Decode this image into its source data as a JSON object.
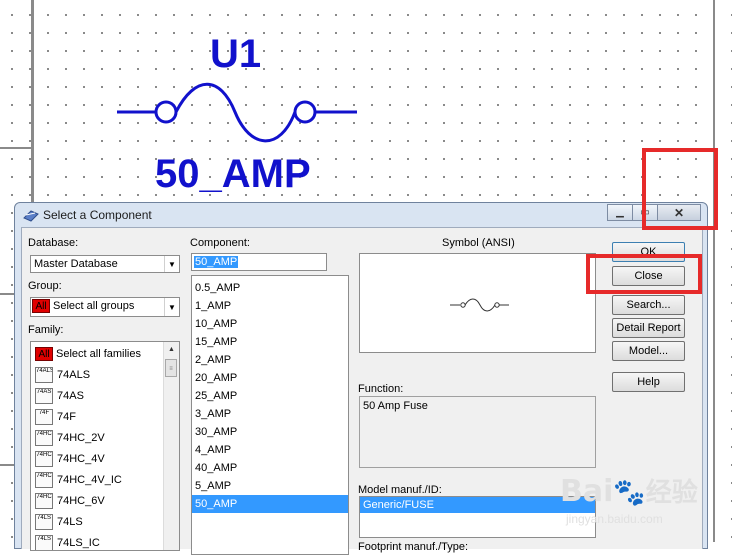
{
  "schematic": {
    "reference": "U1",
    "value": "50_AMP"
  },
  "dialog": {
    "title": "Select a Component",
    "database_label": "Database:",
    "database_value": "Master Database",
    "group_label": "Group:",
    "group_badge": "All",
    "group_value": "Select all groups",
    "family_label": "Family:",
    "families": [
      {
        "icon": "ALL",
        "label": "Select all families"
      },
      {
        "icon": "74ALS",
        "label": "74ALS"
      },
      {
        "icon": "74AS",
        "label": "74AS"
      },
      {
        "icon": "74F",
        "label": "74F"
      },
      {
        "icon": "74HC",
        "label": "74HC_2V"
      },
      {
        "icon": "74HC",
        "label": "74HC_4V"
      },
      {
        "icon": "74HC",
        "label": "74HC_4V_IC"
      },
      {
        "icon": "74HC",
        "label": "74HC_6V"
      },
      {
        "icon": "74LS",
        "label": "74LS"
      },
      {
        "icon": "74LS",
        "label": "74LS_IC"
      }
    ],
    "component_label": "Component:",
    "component_value": "50_AMP",
    "components": [
      "0.5_AMP",
      "1_AMP",
      "10_AMP",
      "15_AMP",
      "2_AMP",
      "20_AMP",
      "25_AMP",
      "3_AMP",
      "30_AMP",
      "4_AMP",
      "40_AMP",
      "5_AMP",
      "50_AMP"
    ],
    "selected_component": "50_AMP",
    "symbol_label": "Symbol (ANSI)",
    "function_label": "Function:",
    "function_value": "50 Amp Fuse",
    "model_label": "Model manuf./ID:",
    "model_value": "Generic/FUSE",
    "footprint_label": "Footprint manuf./Type:",
    "buttons": {
      "ok": "OK",
      "close": "Close",
      "search": "Search...",
      "detail_report": "Detail Report",
      "model": "Model...",
      "help": "Help"
    }
  },
  "watermark": {
    "brand": "Bai",
    "brand_cn": "经验",
    "url": "jingyan.baidu.com"
  },
  "colors": {
    "highlight_box": "#e62a2a",
    "schematic_text": "#1111cc",
    "selection": "#3399ff"
  }
}
